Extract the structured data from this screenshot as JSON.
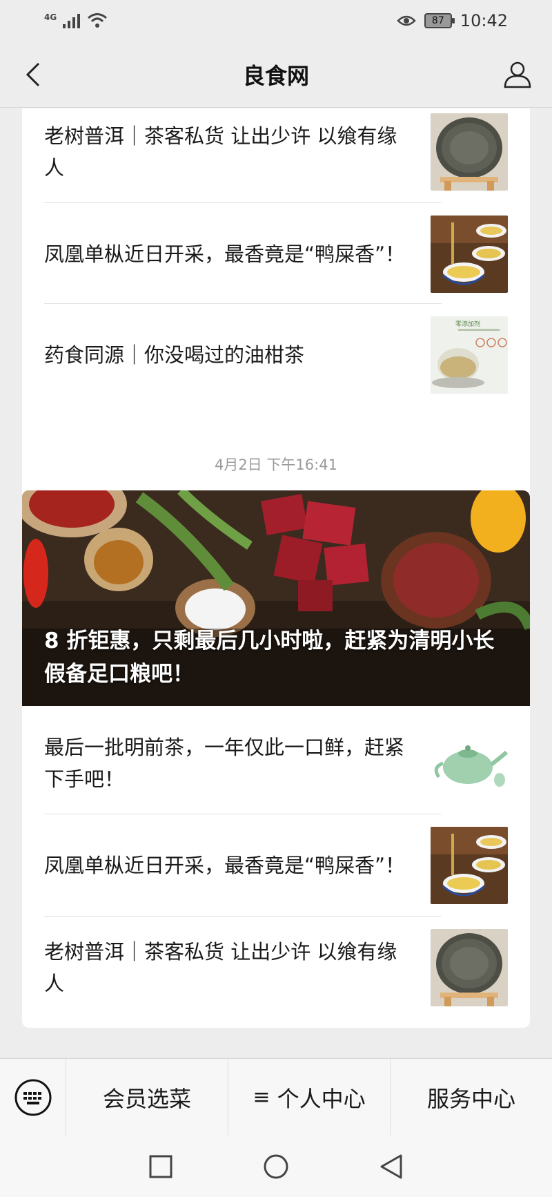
{
  "status": {
    "network": "4G",
    "battery": "87",
    "time": "10:42"
  },
  "nav": {
    "title": "良食网"
  },
  "feed1": {
    "items": [
      {
        "title": "老树普洱｜茶客私货 让出少许 以飨有缘人",
        "thumb": "tea-cake-icon"
      },
      {
        "title": "凤凰单枞近日开采，最香竟是“鸭屎香”！",
        "thumb": "tea-cups-icon"
      },
      {
        "title": "药食同源｜你没喝过的油柑茶",
        "thumb": "glass-teapot-icon"
      }
    ],
    "thumb3_caption": "零添加剂"
  },
  "timestamp": "4月2日 下午16:41",
  "feed2": {
    "hero_title": "8 折钜惠，只剩最后几小时啦，赶紧为清明小长假备足口粮吧！",
    "items": [
      {
        "title": "最后一批明前茶，一年仅此一口鲜，赶紧下手吧！",
        "thumb": "teapot-icon"
      },
      {
        "title": "凤凰单枞近日开采，最香竟是“鸭屎香”！",
        "thumb": "tea-cups-icon"
      },
      {
        "title": "老树普洱｜茶客私货 让出少许 以飨有缘人",
        "thumb": "tea-cake-icon"
      }
    ]
  },
  "menu": {
    "items": [
      {
        "label": "会员选菜"
      },
      {
        "label": "个人中心",
        "icon": "≡"
      },
      {
        "label": "服务中心"
      }
    ]
  }
}
